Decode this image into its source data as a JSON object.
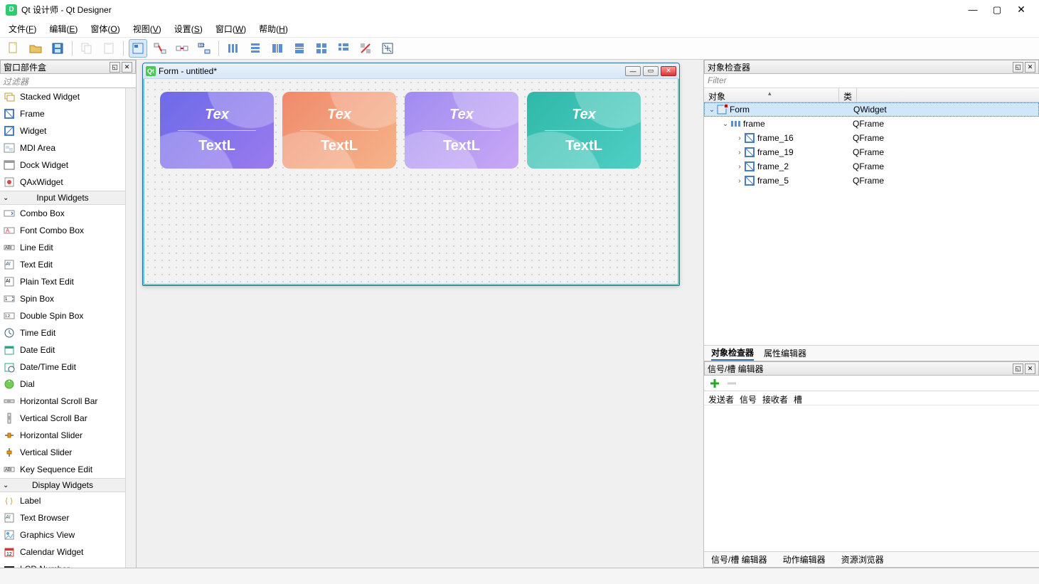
{
  "window": {
    "title": "Qt 设计师 - Qt Designer"
  },
  "menubar": {
    "items": [
      {
        "label": "文件",
        "mnemonic": "F"
      },
      {
        "label": "编辑",
        "mnemonic": "E"
      },
      {
        "label": "窗体",
        "mnemonic": "O"
      },
      {
        "label": "视图",
        "mnemonic": "V"
      },
      {
        "label": "设置",
        "mnemonic": "S"
      },
      {
        "label": "窗口",
        "mnemonic": "W"
      },
      {
        "label": "帮助",
        "mnemonic": "H"
      }
    ]
  },
  "toolbar_icons": [
    "new",
    "open",
    "save",
    "|",
    "copy",
    "paste",
    "|",
    "edit-widgets",
    "edit-signals",
    "edit-buddies",
    "edit-taborder",
    "|",
    "layout-h",
    "layout-v",
    "layout-hsplit",
    "layout-vsplit",
    "layout-grid",
    "layout-form",
    "break-layout",
    "adjust-size"
  ],
  "widgetbox": {
    "title": "窗口部件盒",
    "filter_placeholder": "过滤器",
    "items_top": [
      {
        "label": "Stacked Widget",
        "icon": "stacked"
      },
      {
        "label": "Frame",
        "icon": "frame"
      },
      {
        "label": "Widget",
        "icon": "widget"
      },
      {
        "label": "MDI Area",
        "icon": "mdi"
      },
      {
        "label": "Dock Widget",
        "icon": "dock"
      },
      {
        "label": "QAxWidget",
        "icon": "ax"
      }
    ],
    "category_input": "Input Widgets",
    "items_input": [
      {
        "label": "Combo Box",
        "icon": "combo"
      },
      {
        "label": "Font Combo Box",
        "icon": "fontcombo"
      },
      {
        "label": "Line Edit",
        "icon": "lineedit"
      },
      {
        "label": "Text Edit",
        "icon": "textedit"
      },
      {
        "label": "Plain Text Edit",
        "icon": "plaintext"
      },
      {
        "label": "Spin Box",
        "icon": "spin"
      },
      {
        "label": "Double Spin Box",
        "icon": "doublespin"
      },
      {
        "label": "Time Edit",
        "icon": "time"
      },
      {
        "label": "Date Edit",
        "icon": "date"
      },
      {
        "label": "Date/Time Edit",
        "icon": "datetime"
      },
      {
        "label": "Dial",
        "icon": "dial"
      },
      {
        "label": "Horizontal Scroll Bar",
        "icon": "hscroll"
      },
      {
        "label": "Vertical Scroll Bar",
        "icon": "vscroll"
      },
      {
        "label": "Horizontal Slider",
        "icon": "hslider"
      },
      {
        "label": "Vertical Slider",
        "icon": "vslider"
      },
      {
        "label": "Key Sequence Edit",
        "icon": "keyseq"
      }
    ],
    "category_display": "Display Widgets",
    "items_display": [
      {
        "label": "Label",
        "icon": "label"
      },
      {
        "label": "Text Browser",
        "icon": "browser"
      },
      {
        "label": "Graphics View",
        "icon": "graphics"
      },
      {
        "label": "Calendar Widget",
        "icon": "calendar"
      },
      {
        "label": "LCD Number",
        "icon": "lcd"
      }
    ]
  },
  "form": {
    "title": "Form - untitled*",
    "cards": [
      {
        "top": "Tex",
        "bottom": "TextL"
      },
      {
        "top": "Tex",
        "bottom": "TextL"
      },
      {
        "top": "Tex",
        "bottom": "TextL"
      },
      {
        "top": "Tex",
        "bottom": "TextL"
      }
    ]
  },
  "inspector": {
    "title": "对象检查器",
    "filter_placeholder": "Filter",
    "col_obj": "对象",
    "col_class": "类",
    "tree": [
      {
        "depth": 0,
        "expand": "v",
        "name": "Form",
        "klass": "QWidget",
        "selected": true,
        "icon": "widget-sel"
      },
      {
        "depth": 1,
        "expand": "v",
        "name": "frame",
        "klass": "QFrame",
        "icon": "hlayout"
      },
      {
        "depth": 2,
        "expand": ">",
        "name": "frame_16",
        "klass": "QFrame",
        "icon": "frame"
      },
      {
        "depth": 2,
        "expand": ">",
        "name": "frame_19",
        "klass": "QFrame",
        "icon": "frame"
      },
      {
        "depth": 2,
        "expand": ">",
        "name": "frame_2",
        "klass": "QFrame",
        "icon": "frame"
      },
      {
        "depth": 2,
        "expand": ">",
        "name": "frame_5",
        "klass": "QFrame",
        "icon": "frame"
      }
    ],
    "tabs": {
      "a": "对象检查器",
      "b": "属性编辑器"
    }
  },
  "signals": {
    "title": "信号/槽 编辑器",
    "cols": {
      "a": "发送者",
      "b": "信号",
      "c": "接收者",
      "d": "槽"
    }
  },
  "bottom_tabs": {
    "a": "信号/槽 编辑器",
    "b": "动作编辑器",
    "c": "资源浏览器"
  }
}
